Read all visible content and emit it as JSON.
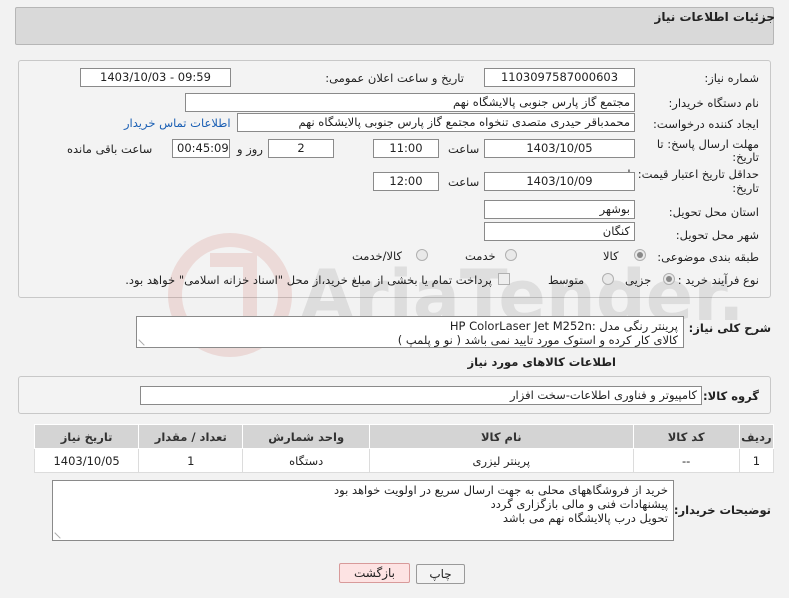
{
  "header": {
    "title": "جزئیات اطلاعات نیاز"
  },
  "form": {
    "need_number": {
      "label": "شماره نیاز:",
      "value": "1103097587000603"
    },
    "announce_datetime": {
      "label": "تاریخ و ساعت اعلان عمومی:",
      "value": "1403/10/03 - 09:59"
    },
    "buyer_org": {
      "label": "نام دستگاه خریدار:",
      "value": "مجتمع گاز پارس جنوبی  پالایشگاه نهم"
    },
    "requester": {
      "label": "ایجاد کننده درخواست:",
      "value": "محمدباقر حیدری متصدی تنخواه مجتمع گاز پارس جنوبی  پالایشگاه نهم",
      "contact_link": "اطلاعات تماس خریدار"
    },
    "reply_deadline": {
      "label_line1": "مهلت ارسال پاسخ: تا",
      "label_line2": "تاریخ:",
      "date": "1403/10/05",
      "time_label": "ساعت",
      "time": "11:00",
      "days": "2",
      "days_label": "روز و",
      "remaining": "00:45:09",
      "remaining_label": "ساعت باقی مانده"
    },
    "price_validity": {
      "label_line1": "حداقل تاریخ اعتبار قیمت: تا",
      "label_line2": "تاریخ:",
      "date": "1403/10/09",
      "time_label": "ساعت",
      "time": "12:00"
    },
    "province": {
      "label": "استان محل تحویل:",
      "value": "بوشهر"
    },
    "city": {
      "label": "شهر محل تحویل:",
      "value": "کنگان"
    },
    "category": {
      "label": "طبقه بندی موضوعی:",
      "options": [
        "کالا",
        "خدمت",
        "کالا/خدمت"
      ],
      "selected": "کالا"
    },
    "purchase_type": {
      "label": "نوع فرآیند خرید :",
      "options": [
        "جزیی",
        "متوسط"
      ],
      "selected": "جزیی",
      "note": "پرداخت تمام یا بخشی از مبلغ خرید،از محل \"اسناد خزانه اسلامی\" خواهد بود."
    }
  },
  "description": {
    "label": "شرح کلی نیاز:",
    "line1": "پرینتر رنگی  مدل  :HP ColorLaser Jet M252n",
    "line2": "کالای کار کرده و استوک مورد تایید نمی باشد ( نو و پلمپ )"
  },
  "goods_section": {
    "title": "اطلاعات کالاهای مورد نیاز",
    "group_label": "گروه کالا:",
    "group_value": "کامپیوتر و فناوری اطلاعات-سخت افزار"
  },
  "table": {
    "headers": [
      "ردیف",
      "کد کالا",
      "نام کالا",
      "واحد شمارش",
      "تعداد / مقدار",
      "تاریخ نیاز"
    ],
    "rows": [
      [
        "1",
        "--",
        "پرینتر لیزری",
        "دستگاه",
        "1",
        "1403/10/05"
      ]
    ]
  },
  "buyer_notes": {
    "label": "توضیحات خریدار:",
    "line1": "خرید از فروشگاههای محلی به جهت ارسال سریع در اولویت خواهد بود",
    "line2": "پیشنهادات فنی و مالی بازگزاری گردد",
    "line3": "تحویل درب پالایشگاه نهم می باشد"
  },
  "buttons": {
    "print": "چاپ",
    "back": "بازگشت"
  },
  "colors": {
    "link": "#1a5fb4",
    "back_button": "#fde3e3",
    "header": "#d9d9d9"
  }
}
